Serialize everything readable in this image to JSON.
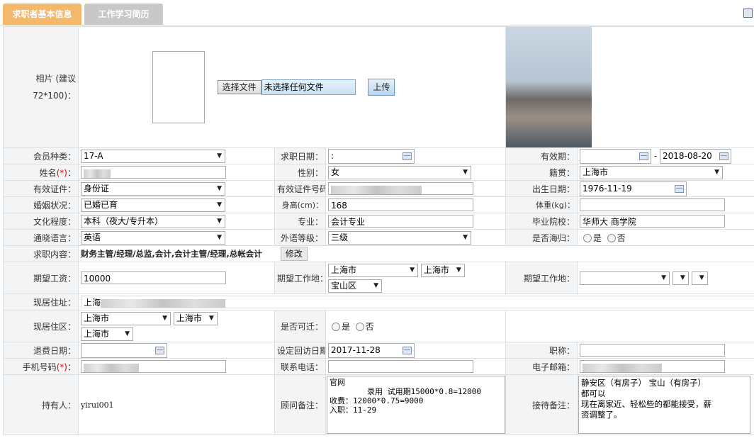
{
  "tabs": {
    "basic": "求职者基本信息",
    "resume": "工作学习简历"
  },
  "photo": {
    "label": "相片 (建议72*100)：",
    "choose_file": "选择文件",
    "no_file": "未选择任何文件",
    "upload": "上传"
  },
  "rows": {
    "member_type_label": "会员种类：",
    "member_type": "17-A",
    "apply_date_label": "求职日期：",
    "apply_date": ":",
    "valid_label": "有效期：",
    "valid_from": "",
    "valid_sep": "-",
    "valid_to": "2018-08-20",
    "name_label": "姓名",
    "name_req": "(*)",
    "name_colon": "：",
    "gender_label": "性别：",
    "gender": "女",
    "native_label": "籍贯：",
    "native": "上海市",
    "idtype_label": "有效证件：",
    "idtype": "身份证",
    "idno_label": "有效证件号码：",
    "birth_label": "出生日期：",
    "birth": "1976-11-19",
    "marital_label": "婚姻状况：",
    "marital": "已婚已育",
    "height_label": "身高(cm)：",
    "height": "168",
    "weight_label": "体重(kg)：",
    "weight": "",
    "edu_label": "文化程度：",
    "edu": "本科（夜大/专升本）",
    "major_label": "专业：",
    "major": "会计专业",
    "school_label": "毕业院校：",
    "school": "华师大 商学院",
    "lang_label": "通晓语言：",
    "lang": "英语",
    "langlevel_label": "外语等级：",
    "langlevel": "三级",
    "overseas_label": "是否海归：",
    "yes": "是",
    "no": "否",
    "job_content_label": "求职内容：",
    "job_content": "财务主管/经理/总监,会计,会计主管/经理,总帐会计",
    "modify": "修改",
    "salary_label": "期望工资：",
    "salary": "10000",
    "workplace_label": "期望工作地：",
    "wp_city": "上海市",
    "wp_city2": "上海市",
    "wp_district": "宝山区",
    "workplace2_label": "期望工作地：",
    "addr_label": "现居住址：",
    "addr_prefix": "上海",
    "live_label": "现居住区：",
    "live_city": "上海市",
    "live_city2": "上海市",
    "live_city3": "上海市",
    "relocate_label": "是否可迁：",
    "refund_label": "退费日期：",
    "revisit_label": "设定回访日期：",
    "revisit": "2017-11-28",
    "title_label": "职称：",
    "mobile_label": "手机号码",
    "mobile_req": "(*)",
    "mobile_colon": "：",
    "tel_label": "联系电话：",
    "email_label": "电子邮箱：",
    "holder_label": "持有人：",
    "holder": "yirui001",
    "advisor_label": "顾问备注：",
    "advisor_note": "官网\n        录用 试用期15000*0.8=12000\n收费：12000*0.75=9000\n入职：11-29",
    "reception_label": "接待备注：",
    "reception_note": "静安区（有房子） 宝山（有房子）\n都可以\n现在离家近、轻松些的都能接受，薪\n资调整了。"
  }
}
